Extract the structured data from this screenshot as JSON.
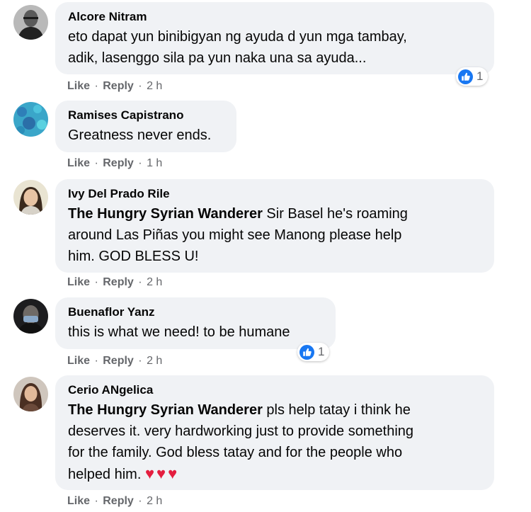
{
  "comments": [
    {
      "author": "Alcore Nitram",
      "lines": [
        "eto dapat yun binibigyan ng ayuda d yun mga tambay,",
        "adik, lasenggo sila pa yun naka una sa ayuda..."
      ],
      "like": "Like",
      "reply": "Reply",
      "time": "2 h",
      "reactions": "1"
    },
    {
      "author": "Ramises Capistrano",
      "lines": [
        "Greatness never ends."
      ],
      "like": "Like",
      "reply": "Reply",
      "time": "1 h"
    },
    {
      "author": "Ivy Del Prado Rile",
      "mention": "The Hungry Syrian Wanderer",
      "lines": [
        " Sir Basel he's roaming",
        "around Las Piñas you might see Manong please help",
        "him. GOD BLESS U!"
      ],
      "like": "Like",
      "reply": "Reply",
      "time": "2 h"
    },
    {
      "author": "Buenaflor Yanz",
      "lines": [
        "this is what we need! to be humane"
      ],
      "like": "Like",
      "reply": "Reply",
      "time": "2 h",
      "reactions": "1"
    },
    {
      "author": "Cerio ANgelica",
      "mention": "The Hungry Syrian Wanderer",
      "lines": [
        " pls help tatay i think he",
        "deserves it. very hardworking just to provide something",
        "for the family. God bless tatay and for the people who",
        "helped him. "
      ],
      "emoji": "♥♥♥",
      "like": "Like",
      "reply": "Reply",
      "time": "2 h"
    }
  ],
  "separator": "·",
  "colors": {
    "bubble": "#f0f2f5",
    "meta": "#65676b",
    "like_blue": "#1877f2",
    "heart": "#e41e3f"
  },
  "icons": {
    "reaction": "like-thumb-icon",
    "emoji": "red-heart-icon"
  }
}
